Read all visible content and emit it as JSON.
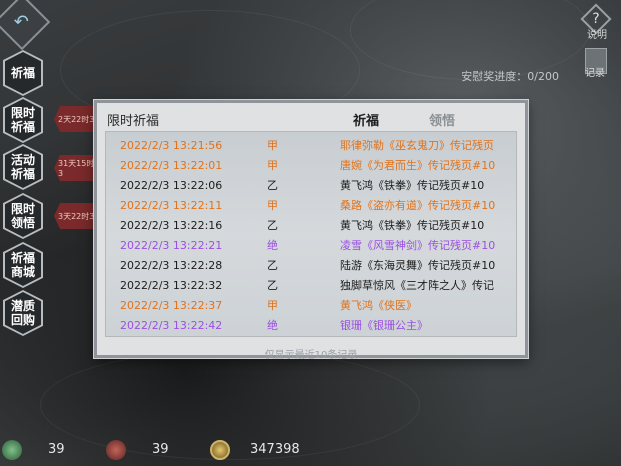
{
  "header": {
    "help_label": "说明",
    "record_label": "记录",
    "progress_text": "安慰奖进度：0/200"
  },
  "side_nav": [
    {
      "label": "祈福"
    },
    {
      "label": "限时祈福",
      "timer": "2天22时3"
    },
    {
      "label": "活动祈福",
      "timer": "31天15时3"
    },
    {
      "label": "限时领悟",
      "timer": "3天22时3"
    },
    {
      "label": "祈福商城"
    },
    {
      "label": "潜质回购"
    }
  ],
  "dialog": {
    "title": "限时祈福",
    "tabs": {
      "active": "祈福",
      "inactive": "领悟"
    },
    "records": [
      {
        "time": "2022/2/3 13:21:56",
        "grade": "甲",
        "item": "耶律弥勒《巫玄鬼刀》传记残页",
        "color": "#e0721a"
      },
      {
        "time": "2022/2/3 13:22:01",
        "grade": "甲",
        "item": "唐婉《为君而生》传记残页#10",
        "color": "#e0721a"
      },
      {
        "time": "2022/2/3 13:22:06",
        "grade": "乙",
        "item": "黄飞鸿《铁拳》传记残页#10",
        "color": "#1c1c1c"
      },
      {
        "time": "2022/2/3 13:22:11",
        "grade": "甲",
        "item": "桑路《盗亦有道》传记残页#10",
        "color": "#e0721a"
      },
      {
        "time": "2022/2/3 13:22:16",
        "grade": "乙",
        "item": "黄飞鸿《铁拳》传记残页#10",
        "color": "#1c1c1c"
      },
      {
        "time": "2022/2/3 13:22:21",
        "grade": "绝",
        "item": "凌雪《风雪神剑》传记残页#10",
        "color": "#9a4fe0"
      },
      {
        "time": "2022/2/3 13:22:28",
        "grade": "乙",
        "item": "陆游《东海灵舞》传记残页#10",
        "color": "#1c1c1c"
      },
      {
        "time": "2022/2/3 13:22:32",
        "grade": "乙",
        "item": "独脚草惊风《三才阵之人》传记",
        "color": "#1c1c1c"
      },
      {
        "time": "2022/2/3 13:22:37",
        "grade": "甲",
        "item": "黄飞鸿《侠医》",
        "color": "#e0721a"
      },
      {
        "time": "2022/2/3 13:22:42",
        "grade": "绝",
        "item": "银珊《银珊公主》",
        "color": "#9a4fe0"
      }
    ],
    "footer_note": "仅显示最近10条记录"
  },
  "bottom_bar": {
    "res1": "39",
    "res2": "39",
    "res3": "347398"
  }
}
